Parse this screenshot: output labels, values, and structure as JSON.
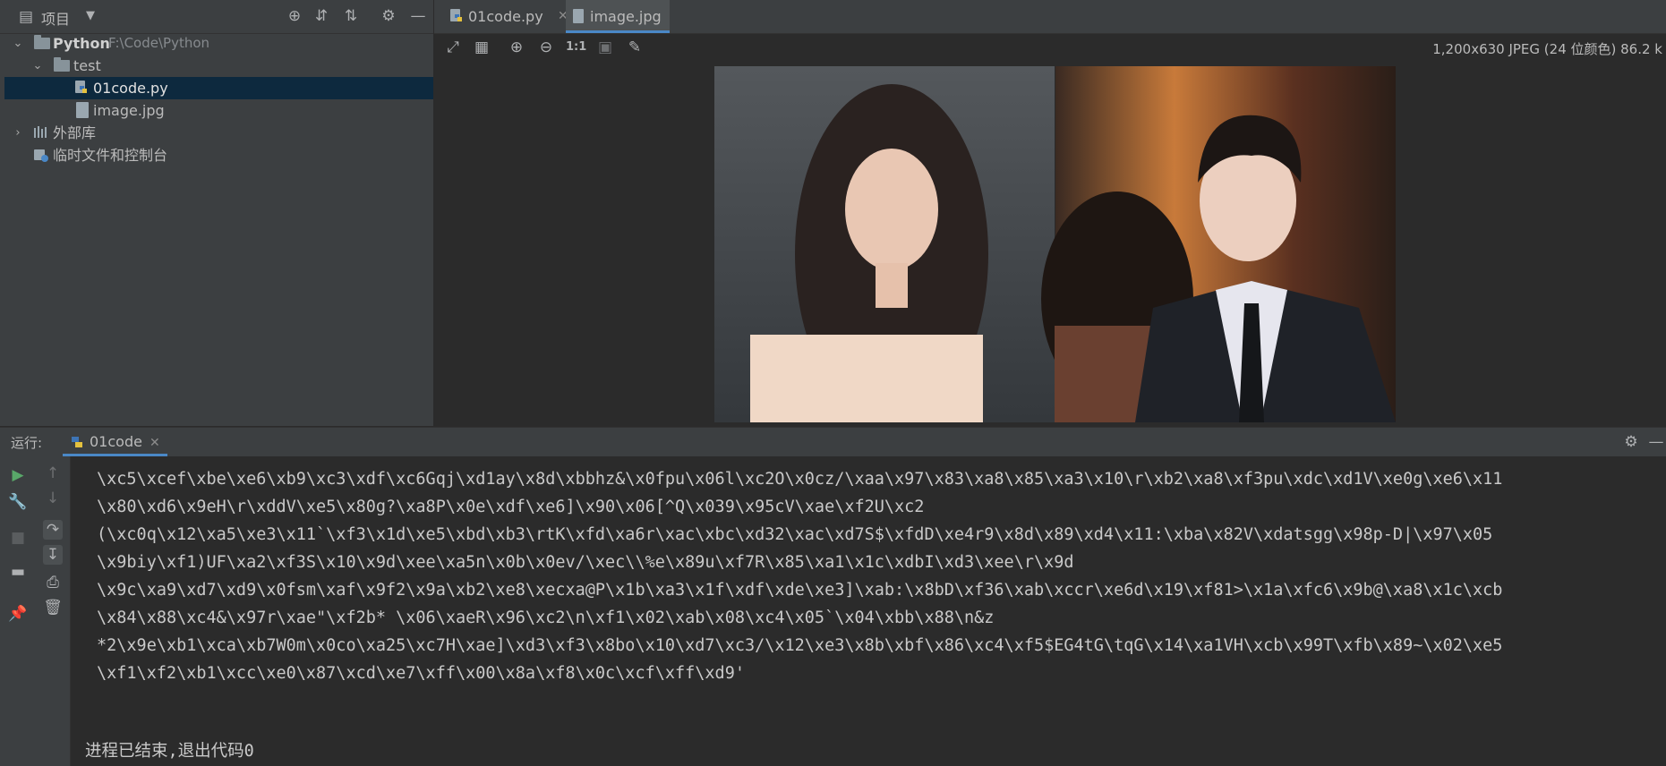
{
  "project_panel": {
    "title": "项目",
    "tree": {
      "root": {
        "name": "Python",
        "path": "F:\\Code\\Python"
      },
      "folder": "test",
      "files": [
        "01code.py",
        "image.jpg"
      ],
      "external_libs": "外部库",
      "scratches": "临时文件和控制台"
    }
  },
  "editor": {
    "tabs": [
      {
        "label": "01code.py",
        "active": false
      },
      {
        "label": "image.jpg",
        "active": true
      }
    ],
    "image_info": "1,200x630 JPEG (24 位颜色) 86.2 k"
  },
  "run": {
    "label": "运行:",
    "tab_label": "01code",
    "output_lines": [
      "\\xc5\\xcef\\xbe\\xe6\\xb9\\xc3\\xdf\\xc6Gqj\\xd1ay\\x8d\\xbbhz&\\x0fpu\\x06l\\xc2O\\x0cz/\\xaa\\x97\\x83\\xa8\\x85\\xa3\\x10\\r\\xb2\\xa8\\xf3pu\\xdc\\xd1V\\xe0g\\xe6\\x11",
      "\\x80\\xd6\\x9eH\\r\\xddV\\xe5\\x80g?\\xa8P\\x0e\\xdf\\xe6]\\x90\\x06[^Q\\x039\\x95cV\\xae\\xf2U\\xc2",
      "(\\xc0q\\x12\\xa5\\xe3\\x11`\\xf3\\x1d\\xe5\\xbd\\xb3\\rtK\\xfd\\xa6r\\xac\\xbc\\xd32\\xac\\xd7S$\\xfdD\\xe4r9\\x8d\\x89\\xd4\\x11:\\xba\\x82V\\xdatsgg\\x98p-D|\\x97\\x05",
      "\\x9biy\\xf1)UF\\xa2\\xf3S\\x10\\x9d\\xee\\xa5n\\x0b\\x0ev/\\xec\\\\%e\\x89u\\xf7R\\x85\\xa1\\x1c\\xdbI\\xd3\\xee\\r\\x9d",
      "\\x9c\\xa9\\xd7\\xd9\\x0fsm\\xaf\\x9f2\\x9a\\xb2\\xe8\\xecxa@P\\x1b\\xa3\\x1f\\xdf\\xde\\xe3]\\xab:\\x8bD\\xf36\\xab\\xccr\\xe6d\\x19\\xf81>\\x1a\\xfc6\\x9b@\\xa8\\x1c\\xcb",
      "\\x84\\x88\\xc4&\\x97r\\xae\"\\xf2b* \\x06\\xaeR\\x96\\xc2\\n\\xf1\\x02\\xab\\x08\\xc4\\x05`\\x04\\xbb\\x88\\n&z",
      "*2\\x9e\\xb1\\xca\\xb7W0m\\x0co\\xa25\\xc7H\\xae]\\xd3\\xf3\\x8bo\\x10\\xd7\\xc3/\\x12\\xe3\\x8b\\xbf\\x86\\xc4\\xf5$EG4tG\\tqG\\x14\\xa1VH\\xcb\\x99T\\xfb\\x89~\\x02\\xe5",
      "\\xf1\\xf2\\xb1\\xcc\\xe0\\x87\\xcd\\xe7\\xff\\x00\\x8a\\xf8\\x0c\\xcf\\xff\\xd9'"
    ],
    "exit_message": "进程已结束,退出代码0"
  },
  "colors": {
    "accent": "#4a88c7",
    "selection": "#0d293e",
    "panel": "#3c3f41",
    "editor_bg": "#2b2b2b"
  }
}
